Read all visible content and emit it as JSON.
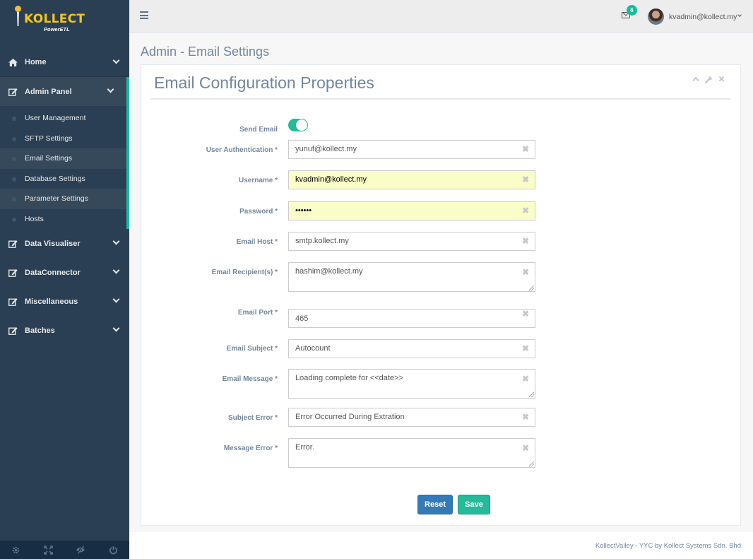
{
  "brand": {
    "name": "KOLLECT",
    "subtitle": "PowerETL"
  },
  "sidebar": {
    "home": {
      "label": "Home",
      "icon": "home-icon"
    },
    "admin_panel": {
      "label": "Admin Panel",
      "icon": "edit-icon",
      "items": [
        {
          "label": "User Management"
        },
        {
          "label": "SFTP Settings"
        },
        {
          "label": "Email Settings"
        },
        {
          "label": "Database Settings"
        },
        {
          "label": "Parameter Settings"
        },
        {
          "label": "Hosts"
        }
      ]
    },
    "sections": [
      {
        "label": "Data Visualiser",
        "icon": "edit-icon"
      },
      {
        "label": "DataConnector",
        "icon": "edit-icon"
      },
      {
        "label": "Miscellaneous",
        "icon": "edit-icon"
      },
      {
        "label": "Batches",
        "icon": "edit-icon"
      }
    ],
    "footer_icons": [
      "gear-icon",
      "fullscreen-icon",
      "eye-slash-icon",
      "power-icon"
    ]
  },
  "topnav": {
    "notification_count": "6",
    "user": "kvadmin@kollect.my"
  },
  "page": {
    "title": "Admin - Email Settings"
  },
  "panel": {
    "title": "Email Configuration Properties",
    "tools": [
      "chevron-up-icon",
      "wrench-icon",
      "close-icon"
    ]
  },
  "form": {
    "send_email": {
      "label": "Send Email",
      "enabled": true
    },
    "user_auth": {
      "label": "User Authentication *",
      "value": "yunuf@kollect.my"
    },
    "username": {
      "label": "Username *",
      "value": "kvadmin@kollect.my"
    },
    "password": {
      "label": "Password *",
      "value": "••••••"
    },
    "email_host": {
      "label": "Email Host *",
      "value": "smtp.kollect.my"
    },
    "recipients": {
      "label": "Email Recipient(s) *",
      "value": "hashim@kollect.my"
    },
    "port": {
      "label": "Email Port *",
      "value": "465"
    },
    "subject": {
      "label": "Email Subject *",
      "value": "Autocount"
    },
    "message": {
      "label": "Email Message *",
      "value": "Loading complete for <<date>>"
    },
    "subject_error": {
      "label": "Subject Error *",
      "value": "Error Occurred During Extration"
    },
    "message_error": {
      "label": "Message Error *",
      "value": "Error."
    }
  },
  "buttons": {
    "reset": "Reset",
    "save": "Save"
  },
  "footer": {
    "text": "KollectValley - YYC by Kollect Systems Sdn. Bhd"
  },
  "colors": {
    "sidebar": "#2a3f54",
    "accent": "#1abb9c",
    "primary": "#337ab7",
    "autofill": "#fafdc8"
  }
}
